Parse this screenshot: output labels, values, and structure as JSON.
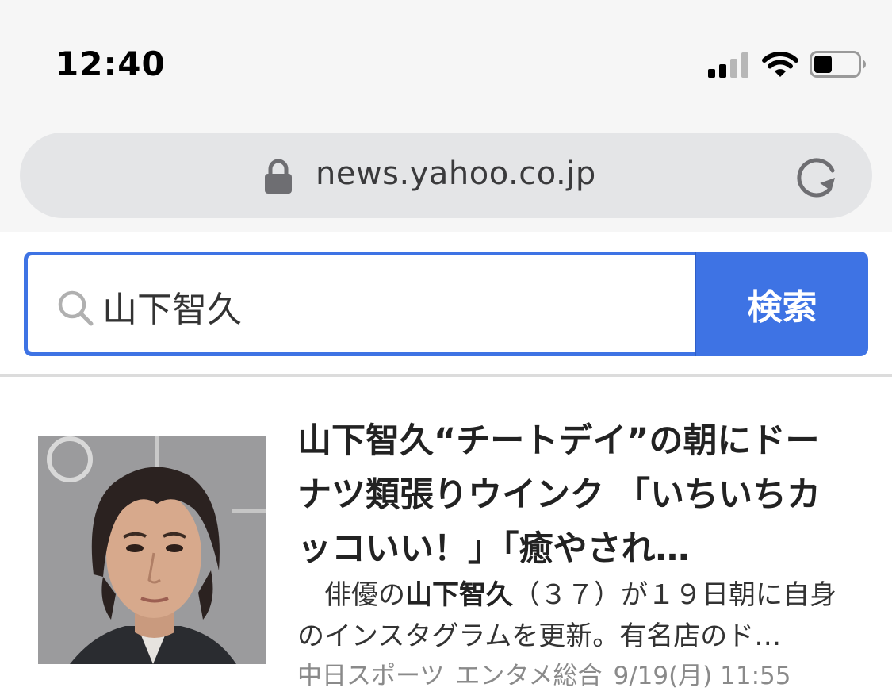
{
  "status_bar": {
    "time": "12:40",
    "signal_icon": "cellular-signal-icon",
    "wifi_icon": "wifi-icon",
    "battery_icon": "battery-icon"
  },
  "browser": {
    "url": "news.yahoo.co.jp",
    "lock_icon": "lock-icon",
    "reload_icon": "reload-icon"
  },
  "search": {
    "query": "山下智久",
    "button_label": "検索",
    "icon": "search-icon",
    "accent_color": "#3e73e4"
  },
  "article": {
    "headline": "山下智久“チートデイ”の朝にドーナツ類張りウインク 「いちいちカッコいい！」「癒やされ…",
    "snippet_prefix": "　俳優の",
    "snippet_highlight": "山下智久",
    "snippet_suffix": "（３７）が１９日朝に自身のインスタグラムを更新。有名店のド…",
    "source": "中日スポーツ",
    "category": "エンタメ総合",
    "date": "9/19(月) 11:55",
    "thumbnail": "portrait-photo"
  }
}
